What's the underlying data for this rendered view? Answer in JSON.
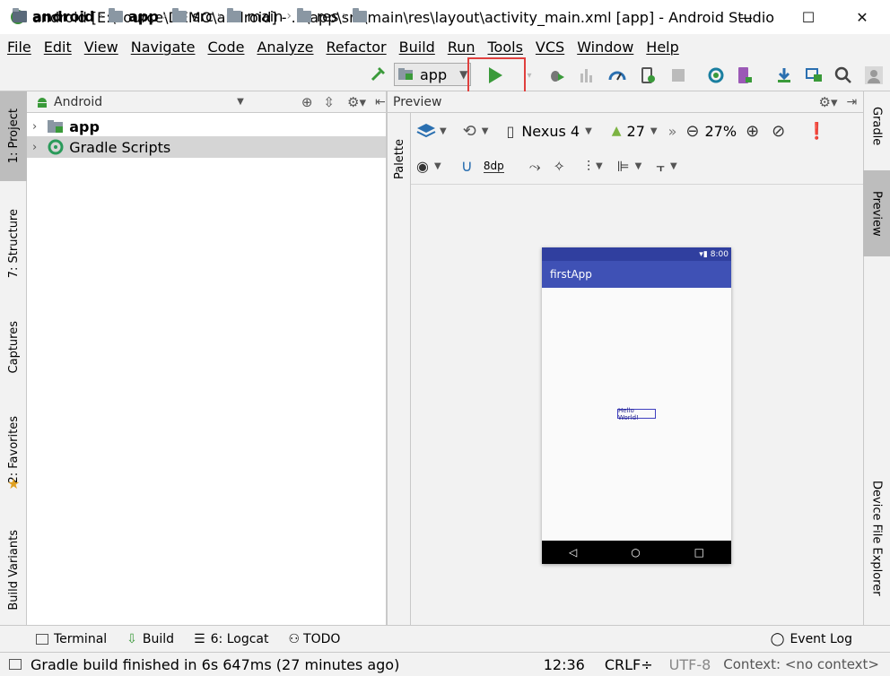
{
  "window": {
    "title": "android [E:\\source\\DEMO\\android] - ...\\app\\src\\main\\res\\layout\\activity_main.xml [app] - Android Studio",
    "controls": {
      "minimize": "—",
      "maximize": "☐",
      "close": "✕"
    }
  },
  "menu": [
    "File",
    "Edit",
    "View",
    "Navigate",
    "Code",
    "Analyze",
    "Refactor",
    "Build",
    "Run",
    "Tools",
    "VCS",
    "Window",
    "Help"
  ],
  "breadcrumb": [
    "android",
    "app",
    "src",
    "main",
    "res"
  ],
  "toolbar": {
    "run_config": "app"
  },
  "left_tabs": [
    "1: Project",
    "7: Structure",
    "Captures",
    "2: Favorites",
    "Build Variants"
  ],
  "project": {
    "view_mode": "Android",
    "items": [
      "app",
      "Gradle Scripts"
    ]
  },
  "preview": {
    "panel_title": "Preview",
    "palette_label": "Palette",
    "device": "Nexus 4",
    "api": "27",
    "zoom": "27%",
    "margin": "8dp"
  },
  "phone": {
    "status_time": "8:00",
    "app_title": "firstApp",
    "content_text": "Hello World!"
  },
  "right_tabs": [
    "Gradle",
    "Preview",
    "Device File Explorer"
  ],
  "bottom_tools": {
    "terminal": "Terminal",
    "build": "Build",
    "logcat": "6: Logcat",
    "todo": "TODO",
    "event_log": "Event Log"
  },
  "status": {
    "message": "Gradle build finished in 6s 647ms (27 minutes ago)",
    "position": "12:36",
    "line_sep": "CRLF÷",
    "encoding": "UTF-8",
    "context": "Context: <no context>"
  },
  "colors": {
    "run_green": "#3a9a3a",
    "highlight_red": "#e0403e",
    "phone_primary": "#3f51b5",
    "phone_dark": "#303f9f"
  }
}
